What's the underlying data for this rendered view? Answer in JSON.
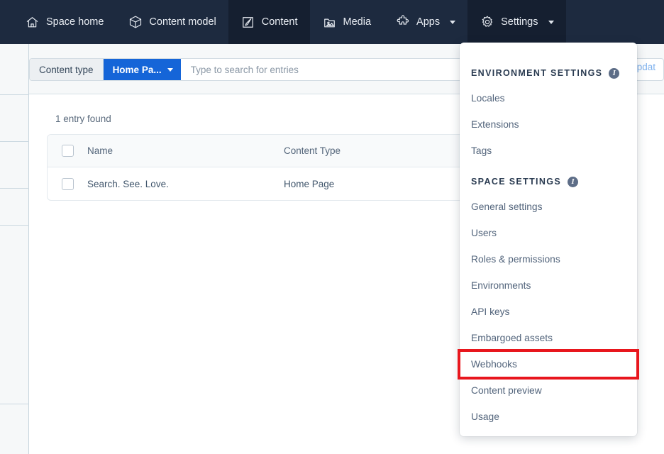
{
  "topnav": {
    "background": "#1d2a3f",
    "active_background": "#151f30",
    "items": [
      {
        "label": "Space home",
        "icon": "home-icon",
        "active": false,
        "caret": false
      },
      {
        "label": "Content model",
        "icon": "content-model-icon",
        "active": false,
        "caret": false
      },
      {
        "label": "Content",
        "icon": "content-icon",
        "active": true,
        "caret": false
      },
      {
        "label": "Media",
        "icon": "media-icon",
        "active": false,
        "caret": false
      },
      {
        "label": "Apps",
        "icon": "apps-puzzle-icon",
        "active": false,
        "caret": true
      },
      {
        "label": "Settings",
        "icon": "gear-icon",
        "active": true,
        "caret": true
      }
    ]
  },
  "toolbar": {
    "content_type_label": "Content type",
    "content_type_value": "Home Pa...",
    "search_placeholder": "Type to search for entries",
    "pill_color": "#1565d8"
  },
  "main": {
    "entry_count": "1 entry found",
    "table": {
      "columns": [
        "Name",
        "Content Type"
      ],
      "rows": [
        {
          "name": "Search. See. Love.",
          "content_type": "Home Page"
        }
      ]
    },
    "update_action": "Updat"
  },
  "settings_menu": {
    "sections": [
      {
        "title": "ENVIRONMENT SETTINGS",
        "info_icon": "info-icon",
        "items": [
          "Locales",
          "Extensions",
          "Tags"
        ]
      },
      {
        "title": "SPACE SETTINGS",
        "info_icon": "info-icon",
        "items": [
          "General settings",
          "Users",
          "Roles & permissions",
          "Environments",
          "API keys",
          "Embargoed assets",
          "Webhooks",
          "Content preview",
          "Usage"
        ]
      }
    ],
    "highlighted_item": "Webhooks",
    "highlight_color": "#e8161d"
  }
}
